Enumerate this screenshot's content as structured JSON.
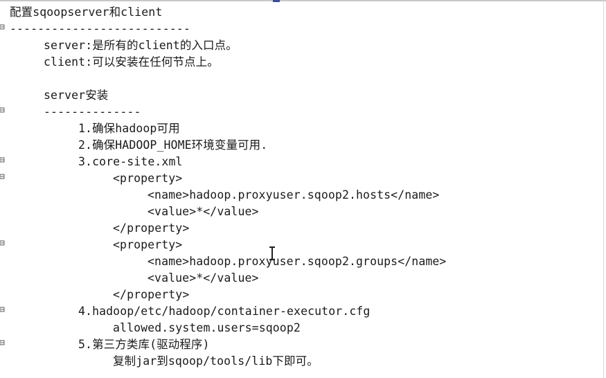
{
  "editor": {
    "lines": [
      "配置sqoopserver和client",
      "--------------------------",
      "server:是所有的client的入口点。",
      "client:可以安装在任何节点上。",
      "server安装",
      "--------------",
      "1.确保hadoop可用",
      "2.确保HADOOP_HOME环境变量可用.",
      "3.core-site.xml",
      "<property>",
      "<name>hadoop.proxyuser.sqoop2.hosts</name>",
      "<value>*</value>",
      "</property>",
      "<property>",
      "<name>hadoop.proxyuser.sqoop2.groups</name>",
      "<value>*</value>",
      "</property>",
      "4.hadoop/etc/hadoop/container-executor.cfg",
      "allowed.system.users=sqoop2",
      "5.第三方类库(驱动程序)",
      "复制jar到sqoop/tools/lib下即可。"
    ],
    "fold_marker": "⊟",
    "colors": {
      "background": "#ffffff",
      "text": "#1a1a1a"
    }
  }
}
